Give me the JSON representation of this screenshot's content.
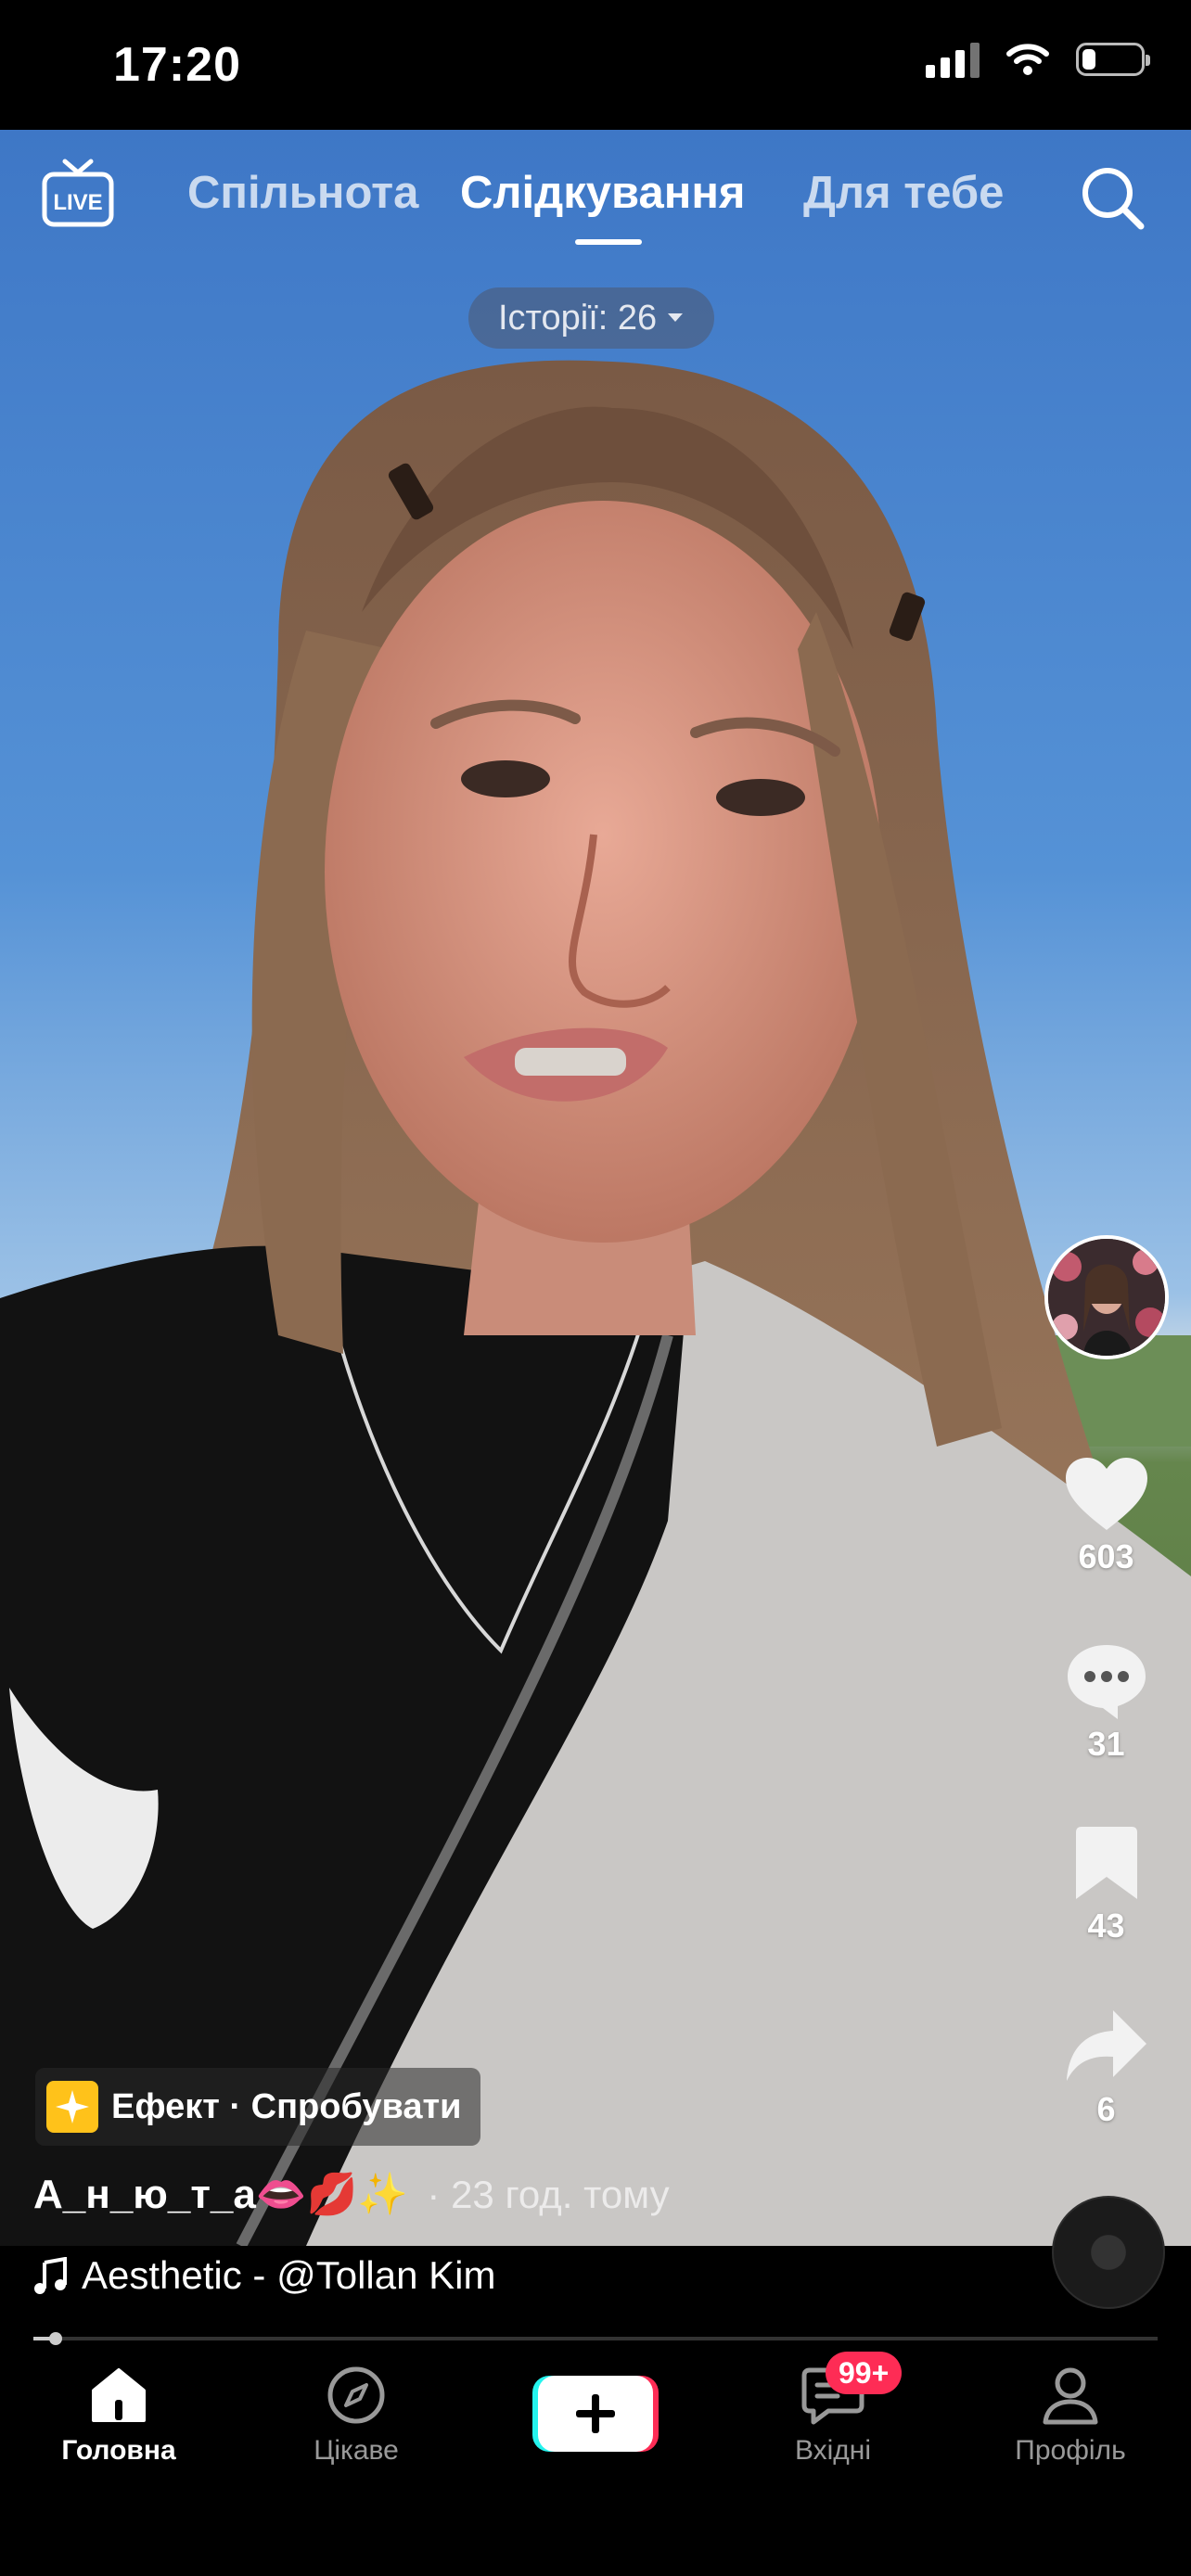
{
  "status_bar": {
    "time": "17:20",
    "battery_level": 0.22
  },
  "top_nav": {
    "tabs": [
      {
        "label": "Спільнота",
        "active": false
      },
      {
        "label": "Слідкування",
        "active": true
      },
      {
        "label": "Для тебе",
        "active": false
      }
    ],
    "live_icon": "live-tv-icon",
    "search_icon": "search-icon",
    "live_label": "LIVE"
  },
  "stories": {
    "label": "Історії: 26"
  },
  "actions": {
    "likes": "603",
    "comments": "31",
    "bookmarks": "43",
    "shares": "6"
  },
  "post": {
    "effect_label": "Ефект · Спробувати",
    "author": "А_н_ю_т_а👄💋✨",
    "time": "· 23 год. тому",
    "music": "Aesthetic - @Tollan Kim",
    "progress": 0.02
  },
  "bottom_nav": {
    "items": [
      {
        "label": "Головна",
        "icon": "home-icon",
        "active": true
      },
      {
        "label": "Цікаве",
        "icon": "compass-icon",
        "active": false
      },
      {
        "label": "",
        "icon": "plus-icon",
        "active": false
      },
      {
        "label": "Вхідні",
        "icon": "inbox-icon",
        "active": false
      },
      {
        "label": "Профіль",
        "icon": "profile-icon",
        "active": false
      }
    ],
    "inbox_badge": "99+"
  },
  "colors": {
    "accent_red": "#fe2c55",
    "accent_cyan": "#25f4ee"
  }
}
